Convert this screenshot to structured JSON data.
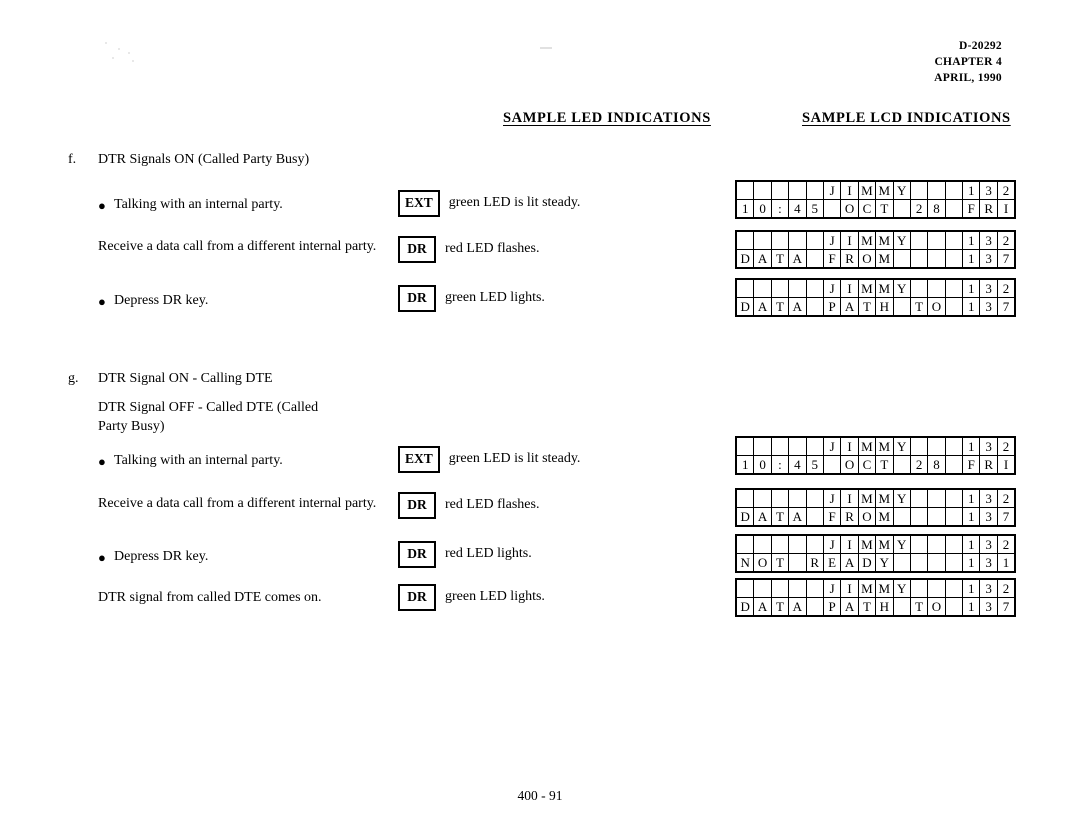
{
  "header": {
    "doc_number": "D-20292",
    "chapter": "CHAPTER 4",
    "date": "APRIL, 1990"
  },
  "columns": {
    "led_heading": "SAMPLE LED INDICATIONS",
    "lcd_heading": "SAMPLE LCD INDICATIONS"
  },
  "sections": [
    {
      "label": "f.",
      "title": "DTR Signals ON (Called Party Busy)",
      "subtitle": "",
      "items": [
        {
          "bullet": true,
          "text": "Talking with an internal party.",
          "key": "EXT",
          "led": "green LED is lit steady."
        },
        {
          "bullet": false,
          "text": "Receive a data call from a different internal party.",
          "key": "DR",
          "led": "red LED flashes."
        },
        {
          "bullet": true,
          "text": "Depress DR key.",
          "key": "DR",
          "led": "green LED lights."
        }
      ],
      "lcds": [
        {
          "row1": [
            "",
            "",
            "",
            "",
            "",
            "J",
            "I",
            "M",
            "M",
            "Y",
            "",
            "",
            "",
            "1",
            "3",
            "2"
          ],
          "row2": [
            "1",
            "0",
            ":",
            "4",
            "5",
            "",
            "O",
            "C",
            "T",
            "",
            "2",
            "8",
            "",
            "F",
            "R",
            "I"
          ]
        },
        {
          "row1": [
            "",
            "",
            "",
            "",
            "",
            "J",
            "I",
            "M",
            "M",
            "Y",
            "",
            "",
            "",
            "1",
            "3",
            "2"
          ],
          "row2": [
            "D",
            "A",
            "T",
            "A",
            "",
            "F",
            "R",
            "O",
            "M",
            "",
            "",
            "",
            "",
            "1",
            "3",
            "7"
          ]
        },
        {
          "row1": [
            "",
            "",
            "",
            "",
            "",
            "J",
            "I",
            "M",
            "M",
            "Y",
            "",
            "",
            "",
            "1",
            "3",
            "2"
          ],
          "row2": [
            "D",
            "A",
            "T",
            "A",
            "",
            "P",
            "A",
            "T",
            "H",
            "",
            "T",
            "O",
            "",
            "1",
            "3",
            "7"
          ]
        }
      ]
    },
    {
      "label": "g.",
      "title": "DTR Signal ON - Calling DTE",
      "subtitle": "DTR Signal OFF - Called DTE (Called Party Busy)",
      "items": [
        {
          "bullet": true,
          "text": "Talking with an internal party.",
          "key": "EXT",
          "led": "green LED is lit steady."
        },
        {
          "bullet": false,
          "text": "Receive a data call from a different internal party.",
          "key": "DR",
          "led": "red LED flashes."
        },
        {
          "bullet": true,
          "text": "Depress DR key.",
          "key": "DR",
          "led": "red LED lights."
        },
        {
          "bullet": false,
          "text": "DTR signal from called DTE  comes on.",
          "key": "DR",
          "led": "green LED lights."
        }
      ],
      "lcds": [
        {
          "row1": [
            "",
            "",
            "",
            "",
            "",
            "J",
            "I",
            "M",
            "M",
            "Y",
            "",
            "",
            "",
            "1",
            "3",
            "2"
          ],
          "row2": [
            "1",
            "0",
            ":",
            "4",
            "5",
            "",
            "O",
            "C",
            "T",
            "",
            "2",
            "8",
            "",
            "F",
            "R",
            "I"
          ]
        },
        {
          "row1": [
            "",
            "",
            "",
            "",
            "",
            "J",
            "I",
            "M",
            "M",
            "Y",
            "",
            "",
            "",
            "1",
            "3",
            "2"
          ],
          "row2": [
            "D",
            "A",
            "T",
            "A",
            "",
            "F",
            "R",
            "O",
            "M",
            "",
            "",
            "",
            "",
            "1",
            "3",
            "7"
          ]
        },
        {
          "row1": [
            "",
            "",
            "",
            "",
            "",
            "J",
            "I",
            "M",
            "M",
            "Y",
            "",
            "",
            "",
            "1",
            "3",
            "2"
          ],
          "row2": [
            "N",
            "O",
            "T",
            "",
            "R",
            "E",
            "A",
            "D",
            "Y",
            "",
            "",
            "",
            "",
            "1",
            "3",
            "1"
          ]
        },
        {
          "row1": [
            "",
            "",
            "",
            "",
            "",
            "J",
            "I",
            "M",
            "M",
            "Y",
            "",
            "",
            "",
            "1",
            "3",
            "2"
          ],
          "row2": [
            "D",
            "A",
            "T",
            "A",
            "",
            "P",
            "A",
            "T",
            "H",
            "",
            "T",
            "O",
            "",
            "1",
            "3",
            "7"
          ]
        }
      ]
    }
  ],
  "footer": {
    "page_number": "400 - 91"
  },
  "bullet_glyph": "●"
}
